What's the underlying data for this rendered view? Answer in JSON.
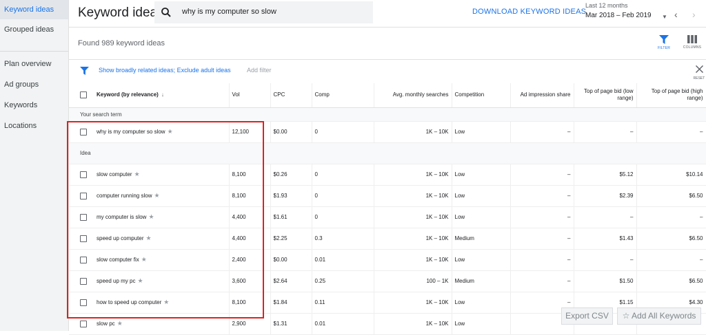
{
  "sidebar": {
    "items": [
      {
        "label": "Keyword ideas",
        "active": true
      },
      {
        "label": "Grouped ideas"
      },
      {
        "label": "Plan overview"
      },
      {
        "label": "Ad groups"
      },
      {
        "label": "Keywords"
      },
      {
        "label": "Locations"
      }
    ]
  },
  "header": {
    "title": "Keyword ideas",
    "search_value": "why is my computer so slow",
    "download_label": "DOWNLOAD KEYWORD IDEAS",
    "date_label": "Last 12 months",
    "date_value": "Mar 2018 – Feb 2019"
  },
  "toolbar": {
    "found_text": "Found 989 keyword ideas",
    "filter_label": "FILTER",
    "columns_label": "COLUMNS"
  },
  "filter_bar": {
    "link": "Show broadly related ideas; Exclude adult ideas",
    "add_filter": "Add filter",
    "reset_label": "RESET"
  },
  "table": {
    "headers": {
      "keyword": "Keyword (by relevance)",
      "vol": "Vol",
      "cpc": "CPC",
      "comp": "Comp",
      "avg": "Avg. monthly searches",
      "competition": "Competition",
      "ad_share": "Ad impression share",
      "bid_low": "Top of page bid (low range)",
      "bid_high": "Top of page bid (high range)"
    },
    "section_search": "Your search term",
    "section_idea": "Idea",
    "search_row": {
      "keyword": "why is my computer so slow",
      "vol": "12,100",
      "cpc": "$0.00",
      "comp": "0",
      "avg": "1K – 10K",
      "competition": "Low",
      "ad_share": "–",
      "bid_low": "–",
      "bid_high": "–"
    },
    "idea_rows": [
      {
        "keyword": "slow computer",
        "vol": "8,100",
        "cpc": "$0.26",
        "comp": "0",
        "avg": "1K – 10K",
        "competition": "Low",
        "ad_share": "–",
        "bid_low": "$5.12",
        "bid_high": "$10.14"
      },
      {
        "keyword": "computer running slow",
        "vol": "8,100",
        "cpc": "$1.93",
        "comp": "0",
        "avg": "1K – 10K",
        "competition": "Low",
        "ad_share": "–",
        "bid_low": "$2.39",
        "bid_high": "$6.50"
      },
      {
        "keyword": "my computer is slow",
        "vol": "4,400",
        "cpc": "$1.61",
        "comp": "0",
        "avg": "1K – 10K",
        "competition": "Low",
        "ad_share": "–",
        "bid_low": "–",
        "bid_high": "–"
      },
      {
        "keyword": "speed up computer",
        "vol": "4,400",
        "cpc": "$2.25",
        "comp": "0.3",
        "avg": "1K – 10K",
        "competition": "Medium",
        "ad_share": "–",
        "bid_low": "$1.43",
        "bid_high": "$6.50"
      },
      {
        "keyword": "slow computer fix",
        "vol": "2,400",
        "cpc": "$0.00",
        "comp": "0.01",
        "avg": "1K – 10K",
        "competition": "Low",
        "ad_share": "–",
        "bid_low": "–",
        "bid_high": "–"
      },
      {
        "keyword": "speed up my pc",
        "vol": "3,600",
        "cpc": "$2.64",
        "comp": "0.25",
        "avg": "100 – 1K",
        "competition": "Medium",
        "ad_share": "–",
        "bid_low": "$1.50",
        "bid_high": "$6.50"
      },
      {
        "keyword": "how to speed up computer",
        "vol": "8,100",
        "cpc": "$1.84",
        "comp": "0.11",
        "avg": "1K – 10K",
        "competition": "Low",
        "ad_share": "–",
        "bid_low": "$1.15",
        "bid_high": "$4.30"
      },
      {
        "keyword": "slow pc",
        "vol": "2,900",
        "cpc": "$1.31",
        "comp": "0.01",
        "avg": "1K – 10K",
        "competition": "Low",
        "ad_share": "–",
        "bid_low": "",
        "bid_high": ""
      }
    ]
  },
  "footer": {
    "export_label": "Export CSV",
    "add_all_label": "Add All Keywords"
  },
  "colors": {
    "accent": "#1a73e8",
    "highlight": "#e01f1f"
  }
}
